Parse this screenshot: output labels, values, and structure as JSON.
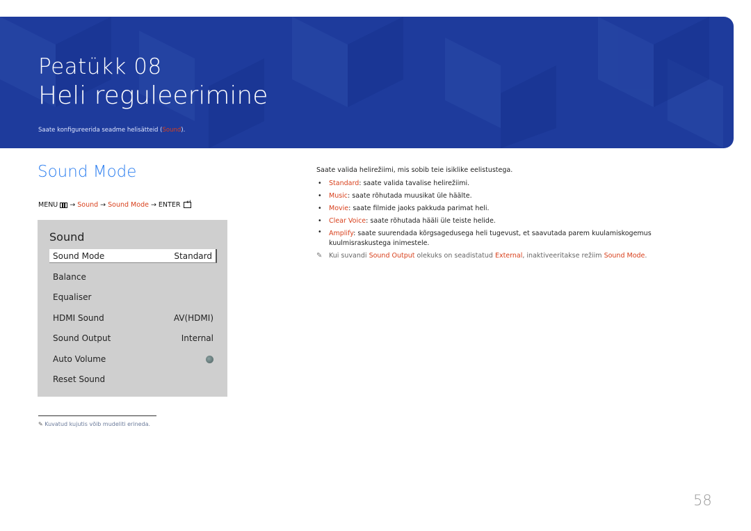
{
  "header": {
    "chapter": "Peatükk  08",
    "title": "Heli reguleerimine",
    "subtitle_pre": "Saate konfigureerida seadme helisätteid (",
    "subtitle_link": "Sound",
    "subtitle_post": ")."
  },
  "section": {
    "title": "Sound Mode",
    "menu_path": {
      "menu": "MENU",
      "arrow": "→",
      "step1": "Sound",
      "step2": "Sound Mode",
      "enter": "ENTER"
    }
  },
  "panel": {
    "title": "Sound",
    "items": [
      {
        "label": "Sound Mode",
        "value": "Standard"
      },
      {
        "label": "Balance",
        "value": ""
      },
      {
        "label": "Equaliser",
        "value": ""
      },
      {
        "label": "HDMI Sound",
        "value": "AV(HDMI)"
      },
      {
        "label": "Sound Output",
        "value": "Internal"
      },
      {
        "label": "Auto Volume",
        "value": ""
      },
      {
        "label": "Reset Sound",
        "value": ""
      }
    ]
  },
  "description": {
    "intro": "Saate valida helirežiimi, mis sobib teie isiklike eelistustega.",
    "bullets": [
      {
        "term": "Standard",
        "text": ": saate valida tavalise helirežiimi."
      },
      {
        "term": "Music",
        "text": ": saate rõhutada muusikat üle häälte."
      },
      {
        "term": "Movie",
        "text": ": saate filmide jaoks pakkuda parimat heli."
      },
      {
        "term": "Clear Voice",
        "text": ": saate rõhutada hääli üle teiste helide."
      },
      {
        "term": "Amplify",
        "text": ": saate suurendada kõrgsagedusega heli tugevust, et saavutada parem kuulamiskogemus kuulmisraskustega inimestele."
      }
    ],
    "note": {
      "p1": "Kui suvandi ",
      "t1": "Sound Output",
      "p2": " olekuks on seadistatud ",
      "t2": "External",
      "p3": ", inaktiveeritakse režiim ",
      "t3": "Sound Mode",
      "p4": "."
    }
  },
  "footnote": "Kuvatud kujutis võib mudeliti erineda.",
  "page_number": "58",
  "colors": {
    "banner": "#1e3b9c",
    "accent_blue": "#2f80f0",
    "accent_red": "#d8401c"
  }
}
